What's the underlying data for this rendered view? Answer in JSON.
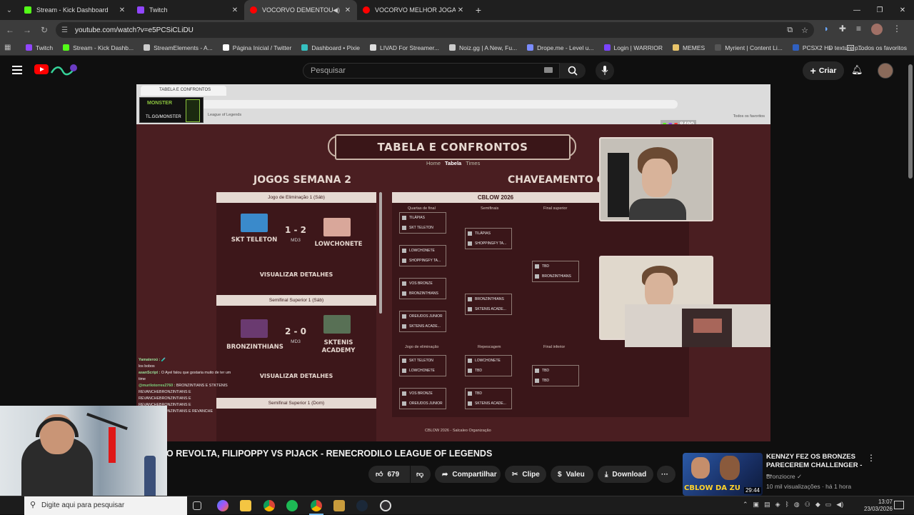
{
  "browser": {
    "tabs": [
      {
        "label": "Stream - Kick Dashboard",
        "color": "#53fc18",
        "active": false
      },
      {
        "label": "Twitch",
        "color": "#9146ff",
        "active": false
      },
      {
        "label": "VOCORVO DEMENTOU TIM",
        "color": "#ff0000",
        "active": true
      },
      {
        "label": "VOCORVO MELHOR JOGADOR",
        "color": "#ff0000",
        "active": false
      }
    ],
    "url": "youtube.com/watch?v=e5PCSiCLiDU",
    "bookmarks": [
      {
        "label": "Twitch",
        "color": "#9146ff"
      },
      {
        "label": "Stream - Kick Dashb...",
        "color": "#53fc18"
      },
      {
        "label": "StreamElements - A...",
        "color": "#cccccc"
      },
      {
        "label": "Página Inicial / Twitter",
        "color": "#ffffff"
      },
      {
        "label": "Dashboard • Pixie",
        "color": "#35c0c0"
      },
      {
        "label": "LIVAD For Streamer...",
        "color": "#dddddd"
      },
      {
        "label": "Noiz.gg | A New, Fu...",
        "color": "#cccccc"
      },
      {
        "label": "Drope.me - Level u...",
        "color": "#7b8cff"
      },
      {
        "label": "Login | WARRIOR",
        "color": "#7a44ff"
      },
      {
        "label": "MEMES",
        "color": "#e8c46a"
      },
      {
        "label": "Myrient | Content Li...",
        "color": "#555555"
      },
      {
        "label": "PCSX2 HD texture p...",
        "color": "#3060c0"
      }
    ],
    "bookmarks_more": "»",
    "favorites_label": "Todos os favoritos"
  },
  "youtube": {
    "search_placeholder": "Pesquisar",
    "create_label": "Criar",
    "video_title": "O REVOLTA, FILIPOPPY VS PIJACK - RENECRODILO LEAGUE OF LEGENDS",
    "likes": "679",
    "share_label": "Compartilhar",
    "clip_label": "Clipe",
    "thanks_label": "Valeu",
    "download_label": "Download",
    "more_label": "···",
    "recommended": {
      "title": "KENNZY FEZ OS BRONZES PARECEREM CHALLENGER - ...",
      "channel": "Bronziocre",
      "meta": "10 mil visualizações · há 1 hora",
      "duration": "29:44",
      "thumb_caption": "CBLOW DA ZU"
    }
  },
  "stream": {
    "inner_tab": "TABELA E CONFRONTOS",
    "inner_url": "...tabela",
    "inner_bm": "League of Legends",
    "inner_fav": "Todos os favoritos",
    "monster_brand": "MONSTER",
    "monster_handle": "TL.GG/MONSTER",
    "viewer_count": "8490",
    "banner": "TABELA E CONFRONTOS",
    "nav": [
      "Home",
      "Tabela",
      "Times"
    ],
    "week_title": "JOGOS SEMANA 2",
    "bracket_title": "CHAVEAMENTO GERAL",
    "matches": [
      {
        "header": "Jogo de Eliminação 1 (Sáb)",
        "team_a": "SKT TELETON",
        "team_b": "LOWCHONETE",
        "score": "1 - 2",
        "format": "MD3",
        "details": "VISUALIZAR DETALHES"
      },
      {
        "header": "Semifinal Superior 1 (Sáb)",
        "team_a": "BRONZINTHIANS",
        "team_b": "SKTENIS ACADEMY",
        "score": "2 - 0",
        "format": "MD3",
        "details": "VISUALIZAR DETALHES"
      },
      {
        "header": "Semifinal Superior 1 (Dom)"
      }
    ],
    "bracket": {
      "header": "CBLOW 2026",
      "rounds": [
        "Quartas de final",
        "Semifinais",
        "Final superior",
        "Jogo de eliminação",
        "Repescagem",
        "Final inferior"
      ],
      "matches": [
        {
          "a": "TILÁPIAS",
          "b": "SKT TELETON"
        },
        {
          "a": "LOWCHONETE",
          "b": "SHOPPINGFY TA..."
        },
        {
          "a": "VOS BRONZE",
          "b": "BRONZINTHIANS"
        },
        {
          "a": "OREIUDOS JUNIOR",
          "b": "SKTENIS ACADE..."
        },
        {
          "a": "TILÁPIAS",
          "b": "SHOPPINGFY TA..."
        },
        {
          "a": "BRONZINTHIANS",
          "b": "SKTENIS ACADE..."
        },
        {
          "a": "TBD",
          "b": "BRONZINTHIANS"
        },
        {
          "a": "SKT TELETON",
          "b": "LOWCHONETE"
        },
        {
          "a": "VOS BRONZE",
          "b": "OREIUDOS JUNIOR"
        },
        {
          "a": "LOWCHONETE",
          "b": "TBD"
        },
        {
          "a": "TBD",
          "b": "SKTENIS ACADE..."
        },
        {
          "a": "TBD",
          "b": "TBD"
        }
      ],
      "footer": "CBLOW 2026 - Salcaleo Organização"
    }
  },
  "chat": [
    {
      "user": "Yamateroú :",
      "text": "🧪"
    },
    {
      "user": "",
      "text": "los bobos"
    },
    {
      "user": "asanScript :",
      "text": "O Ayel falou que gostaria muito de ter um time"
    },
    {
      "user": "@murilotorres2760 :",
      "text": "BRONZINTIANS E STKTENIS REVANCHEBRONZINTIANS E REVANCHEBRONZINTIANS E REVANCHEBRONZINTIANS E REVANCHEBRONZINTIANS E REVANCHE"
    },
    {
      "user": "",
      "text": "MEC DONALS"
    }
  ],
  "taskbar": {
    "search_placeholder": "Digite aqui para pesquisar",
    "time": "13:07",
    "date": "23/03/2026"
  }
}
